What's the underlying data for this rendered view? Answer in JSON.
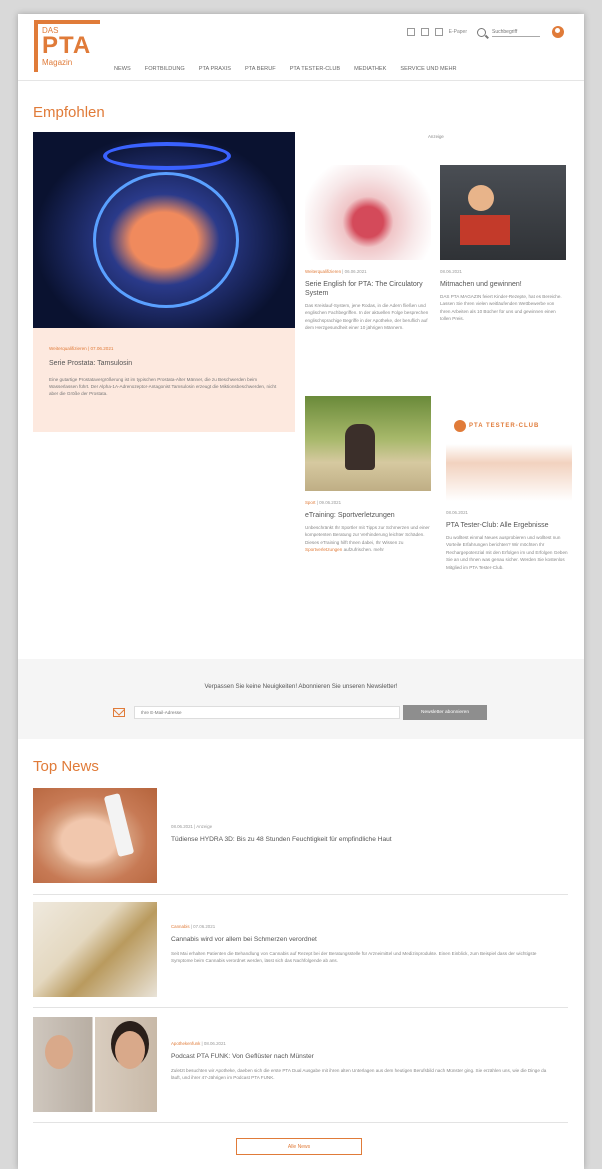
{
  "logo": {
    "das": "DAS",
    "pta": "PTA",
    "magazin": "Magazin"
  },
  "util": {
    "epaper": "E-Paper",
    "search_placeholder": "Suchbegriff"
  },
  "nav": [
    "NEWS",
    "FORTBILDUNG",
    "PTA PRAXIS",
    "PTA BERUF",
    "PTA TESTER-CLUB",
    "MEDIATHEK",
    "SERVICE UND MEHR"
  ],
  "recommended": {
    "heading": "Empfohlen",
    "anzeige": "Anzeige",
    "featured": {
      "meta": "Weiterqualifizieren | 07.06.2021",
      "title": "Serie Prostata: Tamsulosin",
      "teaser": "Eine gutartige Prostatavergrößerung ist im typischen Prostata-Alter Männer, die zu Beschwerden beim Wasserlassen führt. Der Alpha-1A-Adrenozeptor-Antagonist Tamsulosin erzeugt die Miktionsbeschwerden, nicht aber die Größe der Prostata."
    },
    "cards": [
      {
        "category": "Weiterqualifizieren",
        "date": "06.06.2021",
        "title": "Serie English for PTA: The Circulatory System",
        "teaser": "Das Kreislauf-System, jene Rodas, in die Adern fließen und englischen Fachbegriffen. In der aktuellen Folge besprechen englischsprachige Begriffe in der Apotheke, der beruflich auf dem Herzgesundheit einer 10 jährigen Männern."
      },
      {
        "category": "",
        "date": "08.06.2021",
        "title": "Mitmachen und gewinnen!",
        "teaser": "DAS PTA MAGAZIN feiert Kinder-Rezepte, hat es Bereiche. Lassen Sie Ihren vielen weitläufenden Wettbewerbe von Ihren Arbeiten als 10 Bücher für uns und gewinnen einen tollen Preis."
      },
      {
        "category": "Sport",
        "date": "09.06.2021",
        "title": "eTraining: Sportverletzungen",
        "teaser": "Unbeschränkt Ihr Sportler mit Tipps zur Schmerzen und einer kompetenten Beratung zur Verhinderung leichter Schäden. Dieses eTraining hilft Ihnen dabei, Ihr Wissen zu",
        "link_text": "Sportverletzungen",
        "teaser_end": "aufzufrischen. mehr"
      },
      {
        "category": "",
        "date": "08.06.2021",
        "title": "PTA Tester-Club: Alle Ergebnisse",
        "teaser": "Du wolltest einmal Neues ausprobieren und wolltest nun Vorteile Erfahrungen berichten? Wir möchten Ihr Rechargepotenzial mit den Erfolgen im und Erfolgen Geben Sie an und Ihnen was genau sicher. Werden Sie kostenlos Mitglied im PTA Tester-Club."
      }
    ],
    "tester_logo_text": "PTA TESTER-CLUB"
  },
  "newsletter": {
    "headline": "Verpassen Sie keine Neuigkeiten! Abonnieren Sie unseren Newsletter!",
    "placeholder": "Ihre E-Mail-Adresse",
    "button": "Newsletter abonnieren"
  },
  "top_news": {
    "heading": "Top News",
    "items": [
      {
        "category": "",
        "date": "08.06.2021 | Anzeige",
        "title": "Tüdiense HYDRA 3D: Bis zu 48 Stunden Feuchtigkeit für empfindliche Haut",
        "teaser": ""
      },
      {
        "category": "Cannabis",
        "date": "07.06.2021",
        "title": "Cannabis wird vor allem bei Schmerzen verordnet",
        "teaser": "Seit Mai erhalten Patienten die Behandlung von Cannabis auf Rezept bei der Beratungsstelle für Arzneimittel und Medizinprodukte. Einen Einblick, zum Beispiel dass der wichtigste Symptome beim Cannabis verordnet werden, lässt sich das Nachfolgende ab ans."
      },
      {
        "category": "Apothekenfunk",
        "date": "08.06.2021",
        "title": "Podcast PTA FUNK: Von Geflüster nach Münster",
        "teaser": "Zuletzt besuchten wir Apotheke, daeben sich die erste PTA Dual Ausgabe mit ihren alten Unterlagen aus dem heutigen Berufsbild nach Münster ging. Sie erzählen uns, wie die Dinge da läuft, und ihrer 47-Jährigen im Podcast PTA FUNK."
      }
    ],
    "more_button": "Alle News"
  }
}
